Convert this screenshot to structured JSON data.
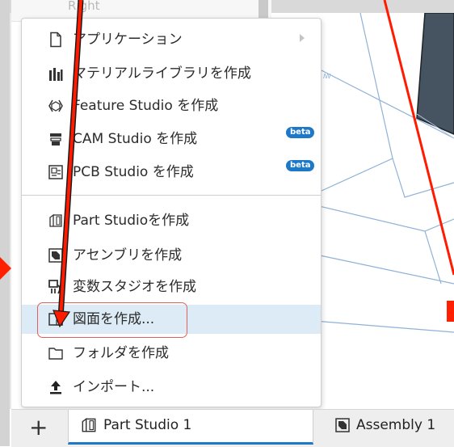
{
  "behind_panel": {
    "label": "Right"
  },
  "menu": {
    "items": [
      {
        "label": "アプリケーション",
        "icon": "document-icon"
      },
      {
        "label": "マテリアルライブラリを作成",
        "icon": "material-library-icon"
      },
      {
        "label": "Feature Studio を作成",
        "icon": "feature-studio-icon"
      },
      {
        "label": "CAM Studio を作成",
        "icon": "cam-studio-icon",
        "badge": "beta"
      },
      {
        "label": "PCB Studio を作成",
        "icon": "pcb-studio-icon",
        "badge": "beta"
      },
      {
        "label": "Part Studioを作成",
        "icon": "part-studio-icon"
      },
      {
        "label": "アセンブリを作成",
        "icon": "assembly-icon"
      },
      {
        "label": "変数スタジオを作成",
        "icon": "variable-studio-icon"
      },
      {
        "label": "図面を作成...",
        "icon": "drawing-icon"
      },
      {
        "label": "フォルダを作成",
        "icon": "folder-icon"
      },
      {
        "label": "インポート...",
        "icon": "import-icon"
      }
    ]
  },
  "tabs": {
    "add_label": "+",
    "active": {
      "label": "Part Studio 1",
      "icon": "part-studio-icon"
    },
    "second": {
      "label": "Assembly 1",
      "icon": "assembly-icon"
    }
  },
  "colors": {
    "accent": "#1e78c8",
    "hover": "#dcebf5",
    "annotation_red": "#ff2000"
  }
}
